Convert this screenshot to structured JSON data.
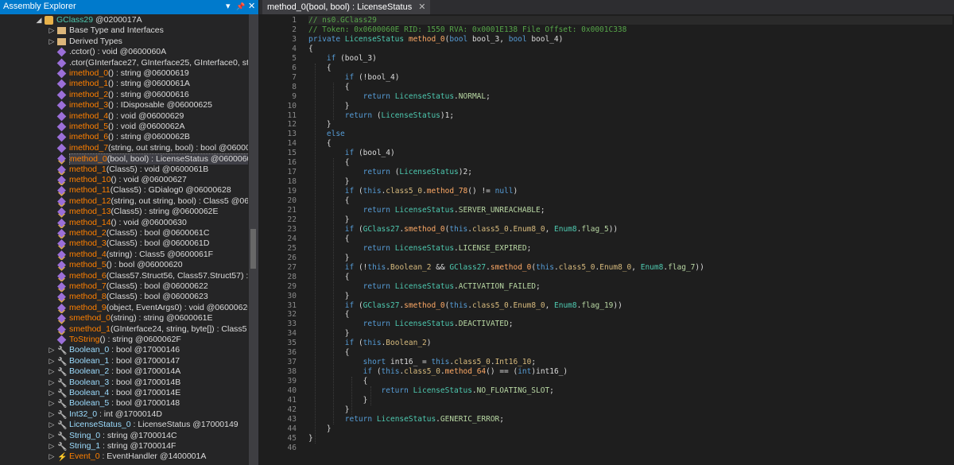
{
  "left_panel": {
    "title": "Assembly Explorer",
    "controls": [
      "▾",
      "📌",
      "✕"
    ],
    "tree": [
      {
        "indent": 3,
        "arrow": "◢",
        "icon": "class",
        "color": "#4ec9b0",
        "text": "GClass29",
        "tail": " @0200017A"
      },
      {
        "indent": 4,
        "arrow": "▷",
        "icon": "folder",
        "text": "Base Type and Interfaces",
        "tail": ""
      },
      {
        "indent": 4,
        "arrow": "▷",
        "icon": "folder",
        "text": "Derived Types",
        "tail": ""
      },
      {
        "indent": 4,
        "icon": "method-purple",
        "text": ".cctor",
        "tail": "() : void @0600060A"
      },
      {
        "indent": 4,
        "icon": "method-purple",
        "text": ".ctor",
        "tail": "(GInterface27, GInterface25, GInterface0, string,"
      },
      {
        "indent": 4,
        "icon": "method-purple",
        "text": "imethod_0",
        "tail": "() : string @06000619",
        "orange": true
      },
      {
        "indent": 4,
        "icon": "method-purple",
        "text": "imethod_1",
        "tail": "() : string @0600061A",
        "orange": true
      },
      {
        "indent": 4,
        "icon": "method-purple",
        "text": "imethod_2",
        "tail": "() : string @06000616",
        "orange": true
      },
      {
        "indent": 4,
        "icon": "method-purple",
        "text": "imethod_3",
        "tail": "() : IDisposable @06000625",
        "orange": true
      },
      {
        "indent": 4,
        "icon": "method-purple",
        "text": "imethod_4",
        "tail": "() : void @06000629",
        "orange": true
      },
      {
        "indent": 4,
        "icon": "method-purple",
        "text": "imethod_5",
        "tail": "() : void @0600062A",
        "orange": true
      },
      {
        "indent": 4,
        "icon": "method-purple",
        "text": "imethod_6",
        "tail": "() : string @0600062B",
        "orange": true
      },
      {
        "indent": 4,
        "icon": "method-purple",
        "text": "imethod_7",
        "tail": "(string, out string, bool) : bool @0600062",
        "orange": true
      },
      {
        "indent": 4,
        "icon": "method-lock",
        "text": "method_0",
        "tail": "(bool, bool) : LicenseStatus @0600060E",
        "orange": true,
        "selected": true
      },
      {
        "indent": 4,
        "icon": "method-lock",
        "text": "method_1",
        "tail": "(Class5) : void @0600061B",
        "orange": true
      },
      {
        "indent": 4,
        "icon": "method-lock",
        "text": "method_10",
        "tail": "() : void @06000627",
        "orange": true
      },
      {
        "indent": 4,
        "icon": "method-lock",
        "text": "method_11",
        "tail": "(Class5) : GDialog0 @06000628",
        "orange": true
      },
      {
        "indent": 4,
        "icon": "method-lock",
        "text": "method_12",
        "tail": "(string, out string, bool) : Class5 @0600",
        "orange": true
      },
      {
        "indent": 4,
        "icon": "method-lock",
        "text": "method_13",
        "tail": "(Class5) : string @0600062E",
        "orange": true
      },
      {
        "indent": 4,
        "icon": "method-lock",
        "text": "method_14",
        "tail": "() : void @06000630",
        "orange": true
      },
      {
        "indent": 4,
        "icon": "method-lock",
        "text": "method_2",
        "tail": "(Class5) : bool @0600061C",
        "orange": true
      },
      {
        "indent": 4,
        "icon": "method-lock",
        "text": "method_3",
        "tail": "(Class5) : bool @0600061D",
        "orange": true
      },
      {
        "indent": 4,
        "icon": "method-lock",
        "text": "method_4",
        "tail": "(string) : Class5 @0600061F",
        "orange": true
      },
      {
        "indent": 4,
        "icon": "method-lock",
        "text": "method_5",
        "tail": "() : bool @06000620",
        "orange": true
      },
      {
        "indent": 4,
        "icon": "method-lock",
        "text": "method_6",
        "tail": "(Class57.Struct56, Class57.Struct57) : bool",
        "orange": true
      },
      {
        "indent": 4,
        "icon": "method-lock",
        "text": "method_7",
        "tail": "(Class5) : bool @06000622",
        "orange": true
      },
      {
        "indent": 4,
        "icon": "method-lock",
        "text": "method_8",
        "tail": "(Class5) : bool @06000623",
        "orange": true
      },
      {
        "indent": 4,
        "icon": "method-lock",
        "text": "method_9",
        "tail": "(object, EventArgs0) : void @06000626",
        "orange": true
      },
      {
        "indent": 4,
        "icon": "method-lock",
        "text": "smethod_0",
        "tail": "(string) : string @0600061E",
        "orange": true
      },
      {
        "indent": 4,
        "icon": "method-lock",
        "text": "smethod_1",
        "tail": "(GInterface24, string, byte[]) : Class5 @06",
        "orange": true
      },
      {
        "indent": 4,
        "icon": "method-purple",
        "text": "ToString",
        "tail": "() : string @0600062F",
        "orange": true
      },
      {
        "indent": 4,
        "arrow": "▷",
        "icon": "property",
        "text": "Boolean_0",
        "tail": " : bool @17000146",
        "cyan": true
      },
      {
        "indent": 4,
        "arrow": "▷",
        "icon": "property",
        "text": "Boolean_1",
        "tail": " : bool @17000147",
        "cyan": true
      },
      {
        "indent": 4,
        "arrow": "▷",
        "icon": "property",
        "text": "Boolean_2",
        "tail": " : bool @1700014A",
        "cyan": true
      },
      {
        "indent": 4,
        "arrow": "▷",
        "icon": "property",
        "text": "Boolean_3",
        "tail": " : bool @1700014B",
        "cyan": true
      },
      {
        "indent": 4,
        "arrow": "▷",
        "icon": "property",
        "text": "Boolean_4",
        "tail": " : bool @1700014E",
        "cyan": true
      },
      {
        "indent": 4,
        "arrow": "▷",
        "icon": "property",
        "text": "Boolean_5",
        "tail": " : bool @17000148",
        "cyan": true
      },
      {
        "indent": 4,
        "arrow": "▷",
        "icon": "property",
        "text": "Int32_0",
        "tail": " : int @1700014D",
        "cyan": true
      },
      {
        "indent": 4,
        "arrow": "▷",
        "icon": "property",
        "text": "LicenseStatus_0",
        "tail": " : LicenseStatus @17000149",
        "cyan": true
      },
      {
        "indent": 4,
        "arrow": "▷",
        "icon": "property",
        "text": "String_0",
        "tail": " : string @1700014C",
        "cyan": true
      },
      {
        "indent": 4,
        "arrow": "▷",
        "icon": "property",
        "text": "String_1",
        "tail": " : string @1700014F",
        "cyan": true
      },
      {
        "indent": 4,
        "arrow": "▷",
        "icon": "event",
        "text": "Event_0",
        "tail": " : EventHandler @1400001A",
        "orange": true
      }
    ]
  },
  "editor": {
    "tab_label": "method_0(bool, bool) : LicenseStatus",
    "tab_close": "✕",
    "lines": [
      [
        [
          "cm",
          "// ns0.GClass29"
        ]
      ],
      [
        [
          "cm",
          "// Token: 0x0600060E RID: 1550 RVA: 0x0001E138 File Offset: 0x0001C338"
        ]
      ],
      [
        [
          "kw",
          "private "
        ],
        [
          "ty",
          "LicenseStatus "
        ],
        [
          "ora",
          "method_0"
        ],
        [
          "fn",
          "("
        ],
        [
          "kw",
          "bool "
        ],
        [
          "fn",
          "bool_3, "
        ],
        [
          "kw",
          "bool "
        ],
        [
          "fn",
          "bool_4)"
        ]
      ],
      [
        [
          "fn",
          "{"
        ]
      ],
      [
        [
          "fn",
          "    "
        ],
        [
          "kw",
          "if "
        ],
        [
          "fn",
          "(bool_3)"
        ]
      ],
      [
        [
          "fn",
          "    {"
        ]
      ],
      [
        [
          "fn",
          "        "
        ],
        [
          "kw",
          "if "
        ],
        [
          "fn",
          "(!bool_4)"
        ]
      ],
      [
        [
          "fn",
          "        {"
        ]
      ],
      [
        [
          "fn",
          "            "
        ],
        [
          "kw",
          "return "
        ],
        [
          "ty",
          "LicenseStatus"
        ],
        [
          "fn",
          "."
        ],
        [
          "en",
          "NORMAL"
        ],
        [
          "fn",
          ";"
        ]
      ],
      [
        [
          "fn",
          "        }"
        ]
      ],
      [
        [
          "fn",
          "        "
        ],
        [
          "kw",
          "return "
        ],
        [
          "fn",
          "("
        ],
        [
          "ty",
          "LicenseStatus"
        ],
        [
          "fn",
          ")1;"
        ]
      ],
      [
        [
          "fn",
          "    }"
        ]
      ],
      [
        [
          "fn",
          "    "
        ],
        [
          "kw",
          "else"
        ]
      ],
      [
        [
          "fn",
          "    {"
        ]
      ],
      [
        [
          "fn",
          "        "
        ],
        [
          "kw",
          "if "
        ],
        [
          "fn",
          "(bool_4)"
        ]
      ],
      [
        [
          "fn",
          "        {"
        ]
      ],
      [
        [
          "fn",
          "            "
        ],
        [
          "kw",
          "return "
        ],
        [
          "fn",
          "("
        ],
        [
          "ty",
          "LicenseStatus"
        ],
        [
          "fn",
          ")2;"
        ]
      ],
      [
        [
          "fn",
          "        }"
        ]
      ],
      [
        [
          "fn",
          "        "
        ],
        [
          "kw",
          "if "
        ],
        [
          "fn",
          "("
        ],
        [
          "kw",
          "this"
        ],
        [
          "fn",
          "."
        ],
        [
          "fld",
          "class5_0"
        ],
        [
          "fn",
          "."
        ],
        [
          "ora",
          "method_78"
        ],
        [
          "fn",
          "() != "
        ],
        [
          "kw",
          "null"
        ],
        [
          "fn",
          ")"
        ]
      ],
      [
        [
          "fn",
          "        {"
        ]
      ],
      [
        [
          "fn",
          "            "
        ],
        [
          "kw",
          "return "
        ],
        [
          "ty",
          "LicenseStatus"
        ],
        [
          "fn",
          "."
        ],
        [
          "en",
          "SERVER_UNREACHABLE"
        ],
        [
          "fn",
          ";"
        ]
      ],
      [
        [
          "fn",
          "        }"
        ]
      ],
      [
        [
          "fn",
          "        "
        ],
        [
          "kw",
          "if "
        ],
        [
          "fn",
          "("
        ],
        [
          "ty",
          "GClass27"
        ],
        [
          "fn",
          "."
        ],
        [
          "ora",
          "smethod_0"
        ],
        [
          "fn",
          "("
        ],
        [
          "kw",
          "this"
        ],
        [
          "fn",
          "."
        ],
        [
          "fld",
          "class5_0"
        ],
        [
          "fn",
          "."
        ],
        [
          "fld",
          "Enum8_0"
        ],
        [
          "fn",
          ", "
        ],
        [
          "ty",
          "Enum8"
        ],
        [
          "fn",
          "."
        ],
        [
          "en",
          "flag_5"
        ],
        [
          "fn",
          "))"
        ]
      ],
      [
        [
          "fn",
          "        {"
        ]
      ],
      [
        [
          "fn",
          "            "
        ],
        [
          "kw",
          "return "
        ],
        [
          "ty",
          "LicenseStatus"
        ],
        [
          "fn",
          "."
        ],
        [
          "en",
          "LICENSE_EXPIRED"
        ],
        [
          "fn",
          ";"
        ]
      ],
      [
        [
          "fn",
          "        }"
        ]
      ],
      [
        [
          "fn",
          "        "
        ],
        [
          "kw",
          "if "
        ],
        [
          "fn",
          "(!"
        ],
        [
          "kw",
          "this"
        ],
        [
          "fn",
          "."
        ],
        [
          "fld",
          "Boolean_2 "
        ],
        [
          "fn",
          "&& "
        ],
        [
          "ty",
          "GClass27"
        ],
        [
          "fn",
          "."
        ],
        [
          "ora",
          "smethod_0"
        ],
        [
          "fn",
          "("
        ],
        [
          "kw",
          "this"
        ],
        [
          "fn",
          "."
        ],
        [
          "fld",
          "class5_0"
        ],
        [
          "fn",
          "."
        ],
        [
          "fld",
          "Enum8_0"
        ],
        [
          "fn",
          ", "
        ],
        [
          "ty",
          "Enum8"
        ],
        [
          "fn",
          "."
        ],
        [
          "en",
          "flag_7"
        ],
        [
          "fn",
          "))"
        ]
      ],
      [
        [
          "fn",
          "        {"
        ]
      ],
      [
        [
          "fn",
          "            "
        ],
        [
          "kw",
          "return "
        ],
        [
          "ty",
          "LicenseStatus"
        ],
        [
          "fn",
          "."
        ],
        [
          "en",
          "ACTIVATION_FAILED"
        ],
        [
          "fn",
          ";"
        ]
      ],
      [
        [
          "fn",
          "        }"
        ]
      ],
      [
        [
          "fn",
          "        "
        ],
        [
          "kw",
          "if "
        ],
        [
          "fn",
          "("
        ],
        [
          "ty",
          "GClass27"
        ],
        [
          "fn",
          "."
        ],
        [
          "ora",
          "smethod_0"
        ],
        [
          "fn",
          "("
        ],
        [
          "kw",
          "this"
        ],
        [
          "fn",
          "."
        ],
        [
          "fld",
          "class5_0"
        ],
        [
          "fn",
          "."
        ],
        [
          "fld",
          "Enum8_0"
        ],
        [
          "fn",
          ", "
        ],
        [
          "ty",
          "Enum8"
        ],
        [
          "fn",
          "."
        ],
        [
          "en",
          "flag_19"
        ],
        [
          "fn",
          "))"
        ]
      ],
      [
        [
          "fn",
          "        {"
        ]
      ],
      [
        [
          "fn",
          "            "
        ],
        [
          "kw",
          "return "
        ],
        [
          "ty",
          "LicenseStatus"
        ],
        [
          "fn",
          "."
        ],
        [
          "en",
          "DEACTIVATED"
        ],
        [
          "fn",
          ";"
        ]
      ],
      [
        [
          "fn",
          "        }"
        ]
      ],
      [
        [
          "fn",
          "        "
        ],
        [
          "kw",
          "if "
        ],
        [
          "fn",
          "("
        ],
        [
          "kw",
          "this"
        ],
        [
          "fn",
          "."
        ],
        [
          "fld",
          "Boolean_2"
        ],
        [
          "fn",
          ")"
        ]
      ],
      [
        [
          "fn",
          "        {"
        ]
      ],
      [
        [
          "fn",
          "            "
        ],
        [
          "kw",
          "short "
        ],
        [
          "fn",
          "int16_ = "
        ],
        [
          "kw",
          "this"
        ],
        [
          "fn",
          "."
        ],
        [
          "fld",
          "class5_0"
        ],
        [
          "fn",
          "."
        ],
        [
          "fld",
          "Int16_10"
        ],
        [
          "fn",
          ";"
        ]
      ],
      [
        [
          "fn",
          "            "
        ],
        [
          "kw",
          "if "
        ],
        [
          "fn",
          "("
        ],
        [
          "kw",
          "this"
        ],
        [
          "fn",
          "."
        ],
        [
          "fld",
          "class5_0"
        ],
        [
          "fn",
          "."
        ],
        [
          "ora",
          "method_64"
        ],
        [
          "fn",
          "() == ("
        ],
        [
          "kw",
          "int"
        ],
        [
          "fn",
          ")int16_)"
        ]
      ],
      [
        [
          "fn",
          "            {"
        ]
      ],
      [
        [
          "fn",
          "                "
        ],
        [
          "kw",
          "return "
        ],
        [
          "ty",
          "LicenseStatus"
        ],
        [
          "fn",
          "."
        ],
        [
          "en",
          "NO_FLOATING_SLOT"
        ],
        [
          "fn",
          ";"
        ]
      ],
      [
        [
          "fn",
          "            }"
        ]
      ],
      [
        [
          "fn",
          "        }"
        ]
      ],
      [
        [
          "fn",
          "        "
        ],
        [
          "kw",
          "return "
        ],
        [
          "ty",
          "LicenseStatus"
        ],
        [
          "fn",
          "."
        ],
        [
          "en",
          "GENERIC_ERROR"
        ],
        [
          "fn",
          ";"
        ]
      ],
      [
        [
          "fn",
          "    }"
        ]
      ],
      [
        [
          "fn",
          "}"
        ]
      ],
      [
        [
          "fn",
          ""
        ]
      ]
    ]
  },
  "colors": {
    "accent": "#007acc",
    "panel": "#252526",
    "editor_bg": "#1e1e1e"
  }
}
